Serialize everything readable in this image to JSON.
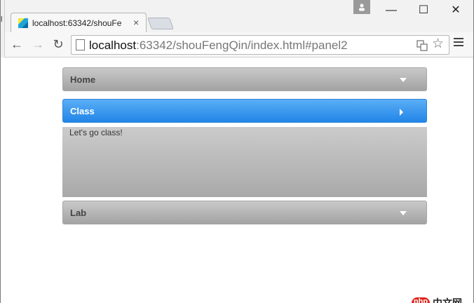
{
  "tab": {
    "title": "localhost:63342/shouFe",
    "close": "×"
  },
  "window_controls": {
    "minimize": "—",
    "maximize": "☐",
    "close": "✕"
  },
  "toolbar": {
    "url_host": "localhost",
    "url_rest": ":63342/shouFengQin/index.html#panel2",
    "back": "←",
    "forward": "→",
    "reload": "↻",
    "star": "☆"
  },
  "left_edge_char": "l",
  "accordion": {
    "panels": [
      {
        "label": "Home",
        "state": "collapsed"
      },
      {
        "label": "Class",
        "state": "expanded",
        "content": "Let's go class!"
      },
      {
        "label": "Lab",
        "state": "collapsed"
      }
    ]
  },
  "watermark": {
    "badge": "php",
    "text": "中文网"
  },
  "colors": {
    "active_header": "#3496ee",
    "inactive_header": "#b5b5b5",
    "body_bg": "#bdbdbd"
  }
}
